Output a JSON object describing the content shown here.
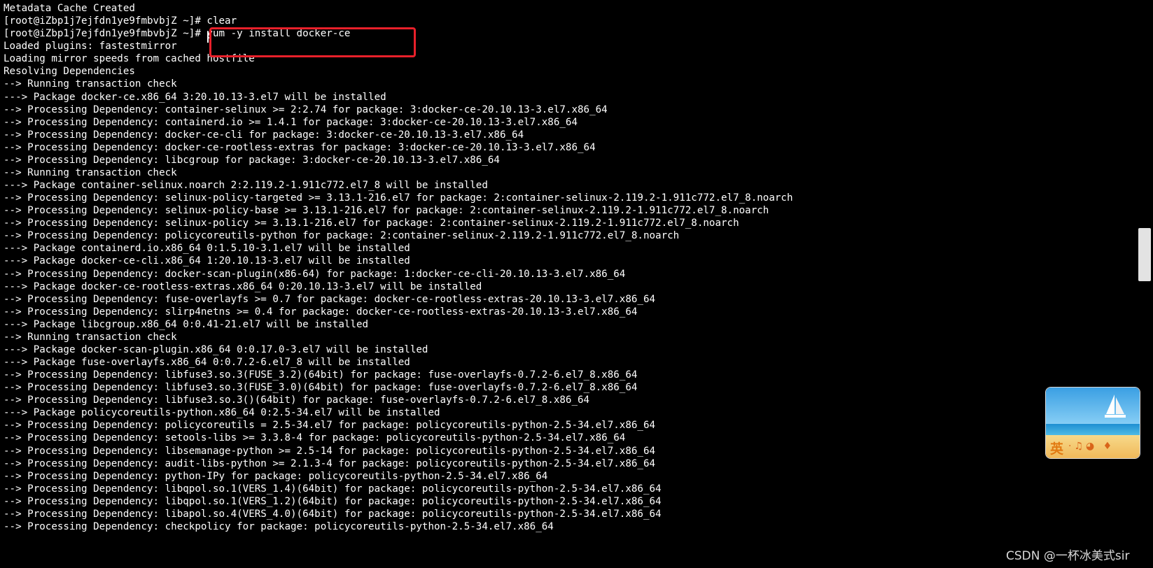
{
  "terminal": {
    "lines": [
      "Metadata Cache Created",
      "[root@iZbp1j7ejfdn1ye9fmbvbjZ ~]# clear",
      "[root@iZbp1j7ejfdn1ye9fmbvbjZ ~]# yum -y install docker-ce",
      "Loaded plugins: fastestmirror",
      "Loading mirror speeds from cached hostfile",
      "Resolving Dependencies",
      "--> Running transaction check",
      "---> Package docker-ce.x86_64 3:20.10.13-3.el7 will be installed",
      "--> Processing Dependency: container-selinux >= 2:2.74 for package: 3:docker-ce-20.10.13-3.el7.x86_64",
      "--> Processing Dependency: containerd.io >= 1.4.1 for package: 3:docker-ce-20.10.13-3.el7.x86_64",
      "--> Processing Dependency: docker-ce-cli for package: 3:docker-ce-20.10.13-3.el7.x86_64",
      "--> Processing Dependency: docker-ce-rootless-extras for package: 3:docker-ce-20.10.13-3.el7.x86_64",
      "--> Processing Dependency: libcgroup for package: 3:docker-ce-20.10.13-3.el7.x86_64",
      "--> Running transaction check",
      "---> Package container-selinux.noarch 2:2.119.2-1.911c772.el7_8 will be installed",
      "--> Processing Dependency: selinux-policy-targeted >= 3.13.1-216.el7 for package: 2:container-selinux-2.119.2-1.911c772.el7_8.noarch",
      "--> Processing Dependency: selinux-policy-base >= 3.13.1-216.el7 for package: 2:container-selinux-2.119.2-1.911c772.el7_8.noarch",
      "--> Processing Dependency: selinux-policy >= 3.13.1-216.el7 for package: 2:container-selinux-2.119.2-1.911c772.el7_8.noarch",
      "--> Processing Dependency: policycoreutils-python for package: 2:container-selinux-2.119.2-1.911c772.el7_8.noarch",
      "---> Package containerd.io.x86_64 0:1.5.10-3.1.el7 will be installed",
      "---> Package docker-ce-cli.x86_64 1:20.10.13-3.el7 will be installed",
      "--> Processing Dependency: docker-scan-plugin(x86-64) for package: 1:docker-ce-cli-20.10.13-3.el7.x86_64",
      "---> Package docker-ce-rootless-extras.x86_64 0:20.10.13-3.el7 will be installed",
      "--> Processing Dependency: fuse-overlayfs >= 0.7 for package: docker-ce-rootless-extras-20.10.13-3.el7.x86_64",
      "--> Processing Dependency: slirp4netns >= 0.4 for package: docker-ce-rootless-extras-20.10.13-3.el7.x86_64",
      "---> Package libcgroup.x86_64 0:0.41-21.el7 will be installed",
      "--> Running transaction check",
      "---> Package docker-scan-plugin.x86_64 0:0.17.0-3.el7 will be installed",
      "---> Package fuse-overlayfs.x86_64 0:0.7.2-6.el7_8 will be installed",
      "--> Processing Dependency: libfuse3.so.3(FUSE_3.2)(64bit) for package: fuse-overlayfs-0.7.2-6.el7_8.x86_64",
      "--> Processing Dependency: libfuse3.so.3(FUSE_3.0)(64bit) for package: fuse-overlayfs-0.7.2-6.el7_8.x86_64",
      "--> Processing Dependency: libfuse3.so.3()(64bit) for package: fuse-overlayfs-0.7.2-6.el7_8.x86_64",
      "---> Package policycoreutils-python.x86_64 0:2.5-34.el7 will be installed",
      "--> Processing Dependency: policycoreutils = 2.5-34.el7 for package: policycoreutils-python-2.5-34.el7.x86_64",
      "--> Processing Dependency: setools-libs >= 3.3.8-4 for package: policycoreutils-python-2.5-34.el7.x86_64",
      "--> Processing Dependency: libsemanage-python >= 2.5-14 for package: policycoreutils-python-2.5-34.el7.x86_64",
      "--> Processing Dependency: audit-libs-python >= 2.1.3-4 for package: policycoreutils-python-2.5-34.el7.x86_64",
      "--> Processing Dependency: python-IPy for package: policycoreutils-python-2.5-34.el7.x86_64",
      "--> Processing Dependency: libqpol.so.1(VERS_1.4)(64bit) for package: policycoreutils-python-2.5-34.el7.x86_64",
      "--> Processing Dependency: libqpol.so.1(VERS_1.2)(64bit) for package: policycoreutils-python-2.5-34.el7.x86_64",
      "--> Processing Dependency: libapol.so.4(VERS_4.0)(64bit) for package: policycoreutils-python-2.5-34.el7.x86_64",
      "--> Processing Dependency: checkpolicy for package: policycoreutils-python-2.5-34.el7.x86_64"
    ]
  },
  "ime": {
    "label": "英",
    "icons": "·♫◕ ♦"
  },
  "watermark": "CSDN @一杯冰美式sir",
  "colors": {
    "background": "#000000",
    "text": "#ffffff",
    "highlight_border": "#e8202a"
  }
}
